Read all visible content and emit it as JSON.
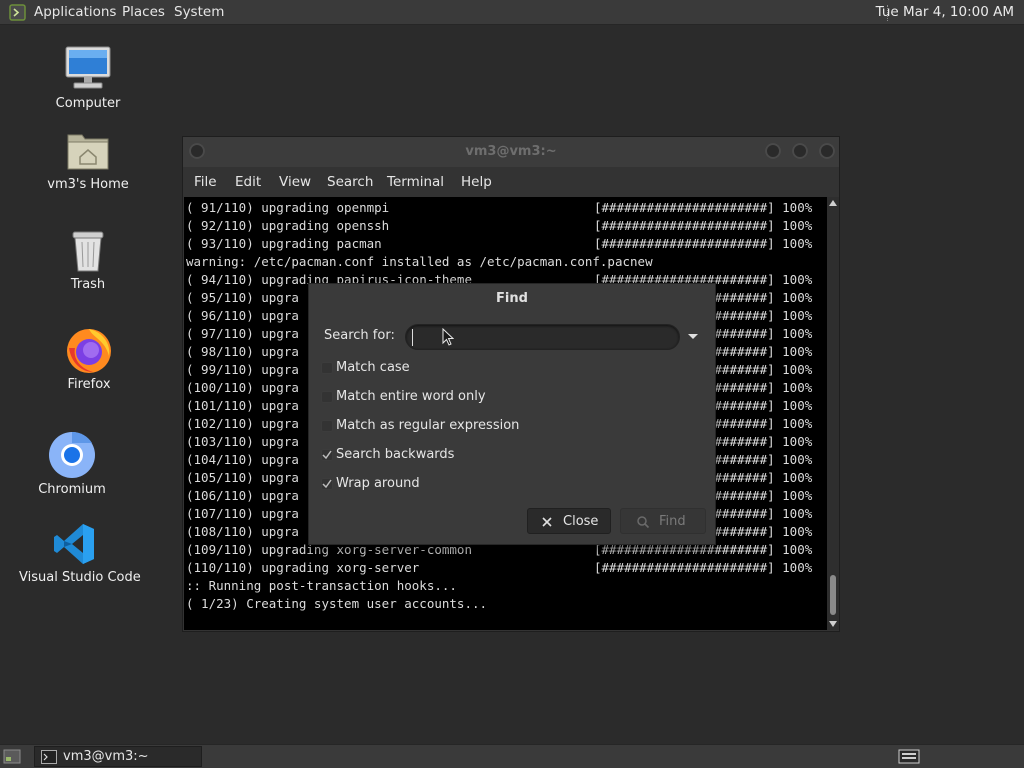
{
  "top_panel": {
    "menus": [
      "Applications",
      "Places",
      "System"
    ],
    "clock": "Tue Mar  4, 10:00 AM"
  },
  "desktop": {
    "icons": [
      {
        "label": "Computer",
        "icon": "computer-icon"
      },
      {
        "label": "vm3's Home",
        "icon": "home-folder-icon"
      },
      {
        "label": "Trash",
        "icon": "trash-icon"
      },
      {
        "label": "Firefox",
        "icon": "firefox-icon"
      },
      {
        "label": "Chromium",
        "icon": "chromium-icon"
      },
      {
        "label": "Visual Studio Code",
        "icon": "vscode-icon"
      }
    ]
  },
  "terminal": {
    "title": "vm3@vm3:~",
    "menu": [
      "File",
      "Edit",
      "View",
      "Search",
      "Terminal",
      "Help"
    ],
    "lines": [
      {
        "text": "( 91/110) upgrading openmpi",
        "bar": "[######################] 100%"
      },
      {
        "text": "( 92/110) upgrading openssh",
        "bar": "[######################] 100%"
      },
      {
        "text": "( 93/110) upgrading pacman",
        "bar": "[######################] 100%"
      },
      {
        "text": "warning: /etc/pacman.conf installed as /etc/pacman.conf.pacnew",
        "bar": ""
      },
      {
        "text": "( 94/110) upgrading papirus-icon-theme",
        "bar": "[######################] 100%"
      },
      {
        "text": "( 95/110) upgra",
        "bar": "[######################] 100%"
      },
      {
        "text": "( 96/110) upgra",
        "bar": "[######################] 100%"
      },
      {
        "text": "( 97/110) upgra",
        "bar": "[######################] 100%"
      },
      {
        "text": "( 98/110) upgra",
        "bar": "[######################] 100%"
      },
      {
        "text": "( 99/110) upgra",
        "bar": "[######################] 100%"
      },
      {
        "text": "(100/110) upgra",
        "bar": "[######################] 100%"
      },
      {
        "text": "(101/110) upgra",
        "bar": "[######################] 100%"
      },
      {
        "text": "(102/110) upgra",
        "bar": "[######################] 100%"
      },
      {
        "text": "(103/110) upgra",
        "bar": "[######################] 100%"
      },
      {
        "text": "(104/110) upgra",
        "bar": "[######################] 100%"
      },
      {
        "text": "(105/110) upgra",
        "bar": "[######################] 100%"
      },
      {
        "text": "(106/110) upgra",
        "bar": "[######################] 100%"
      },
      {
        "text": "(107/110) upgra",
        "bar": "[######################] 100%"
      },
      {
        "text": "(108/110) upgra",
        "bar": "[######################] 100%"
      },
      {
        "text": "(109/110) upgrading xorg-server-common",
        "bar": "[######################] 100%"
      },
      {
        "text": "(110/110) upgrading xorg-server",
        "bar": "[######################] 100%"
      },
      {
        "text": ":: Running post-transaction hooks...",
        "bar": ""
      },
      {
        "text": "( 1/23) Creating system user accounts...",
        "bar": ""
      }
    ]
  },
  "find_dialog": {
    "title": "Find",
    "search_label": "Search for:",
    "search_value": "",
    "options": [
      {
        "label": "Match case",
        "checked": false
      },
      {
        "label": "Match entire word only",
        "checked": false
      },
      {
        "label": "Match as regular expression",
        "checked": false
      },
      {
        "label": "Search backwards",
        "checked": true
      },
      {
        "label": "Wrap around",
        "checked": true
      }
    ],
    "close_label": "Close",
    "find_label": "Find"
  },
  "taskbar": {
    "items": [
      {
        "label": "vm3@vm3:~",
        "icon": "terminal-icon"
      }
    ]
  },
  "colors": {
    "desktop_bg": "#2b2b2b",
    "panel_bg": "#3a3a3a",
    "terminal_bg": "#000000",
    "text": "#dcdcdc"
  }
}
